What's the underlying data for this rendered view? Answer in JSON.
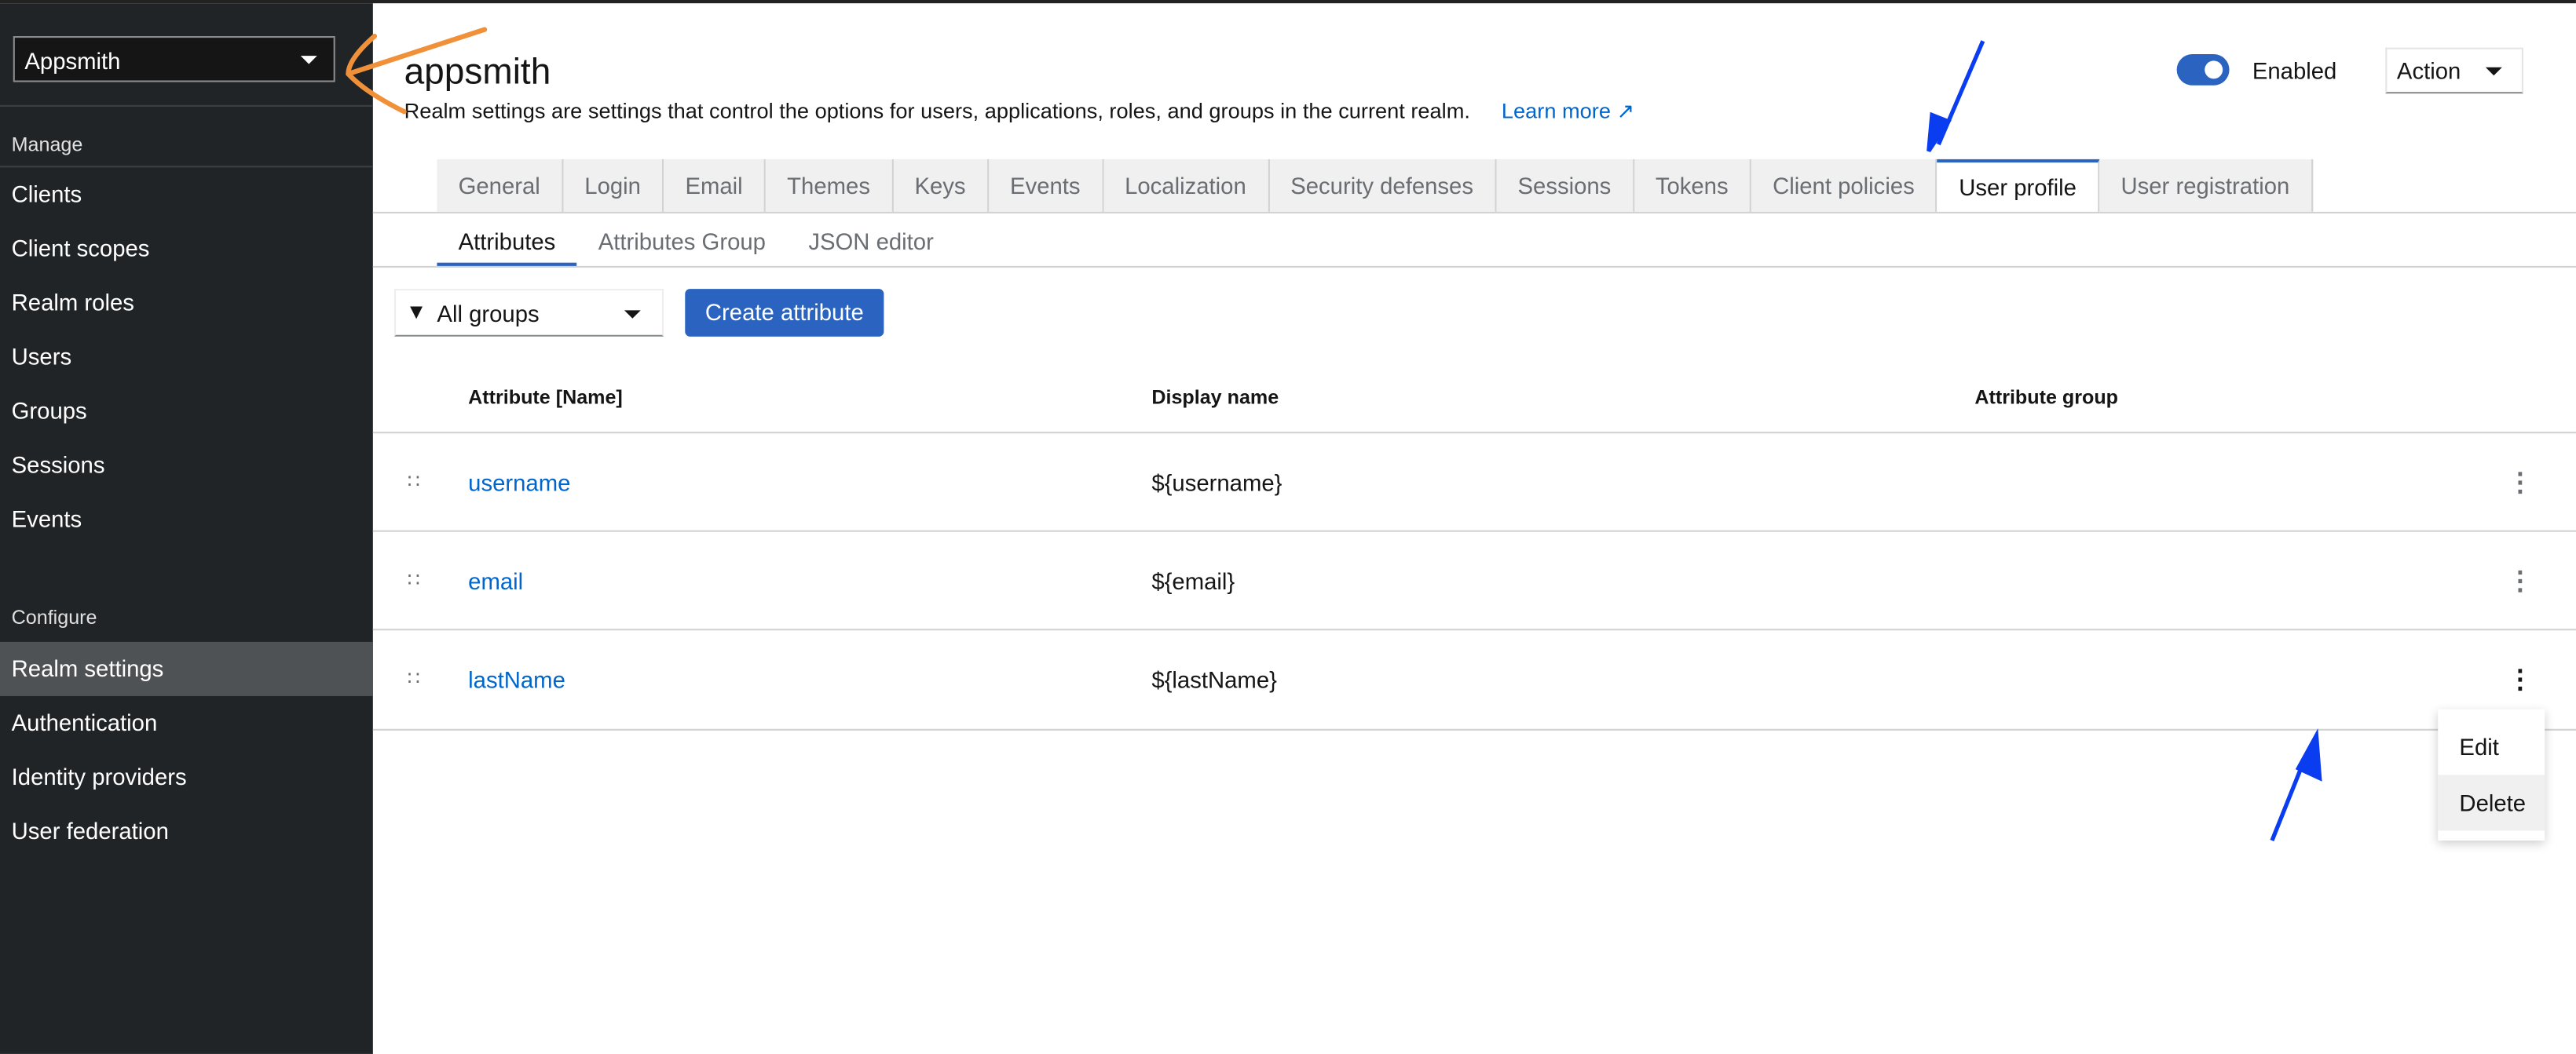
{
  "sidebar": {
    "realm_selector": "Appsmith",
    "sections": [
      {
        "label": "Manage",
        "items": [
          "Clients",
          "Client scopes",
          "Realm roles",
          "Users",
          "Groups",
          "Sessions",
          "Events"
        ]
      },
      {
        "label": "Configure",
        "items": [
          "Realm settings",
          "Authentication",
          "Identity providers",
          "User federation"
        ]
      }
    ],
    "active_item": "Realm settings"
  },
  "header": {
    "title": "appsmith",
    "description": "Realm settings are settings that control the options for users, applications, roles, and groups in the current realm.",
    "learn_more": "Learn more",
    "toggle_label": "Enabled",
    "toggle_on": true,
    "action_label": "Action"
  },
  "tabs": [
    "General",
    "Login",
    "Email",
    "Themes",
    "Keys",
    "Events",
    "Localization",
    "Security defenses",
    "Sessions",
    "Tokens",
    "Client policies",
    "User profile",
    "User registration"
  ],
  "active_tab": "User profile",
  "subtabs": [
    "Attributes",
    "Attributes Group",
    "JSON editor"
  ],
  "active_subtab": "Attributes",
  "toolbar": {
    "filter_value": "All groups",
    "create_label": "Create attribute"
  },
  "table": {
    "columns": [
      "Attribute [Name]",
      "Display name",
      "Attribute group"
    ],
    "rows": [
      {
        "name": "username",
        "display": "${username}",
        "group": ""
      },
      {
        "name": "email",
        "display": "${email}",
        "group": ""
      },
      {
        "name": "lastName",
        "display": "${lastName}",
        "group": ""
      }
    ]
  },
  "row_menu": {
    "items": [
      "Edit",
      "Delete"
    ],
    "hovered": "Delete"
  },
  "colors": {
    "accent": "#2b63c0",
    "sidebar": "#212427",
    "annotation_orange": "#f0913a",
    "annotation_blue": "#0a3cf0"
  }
}
